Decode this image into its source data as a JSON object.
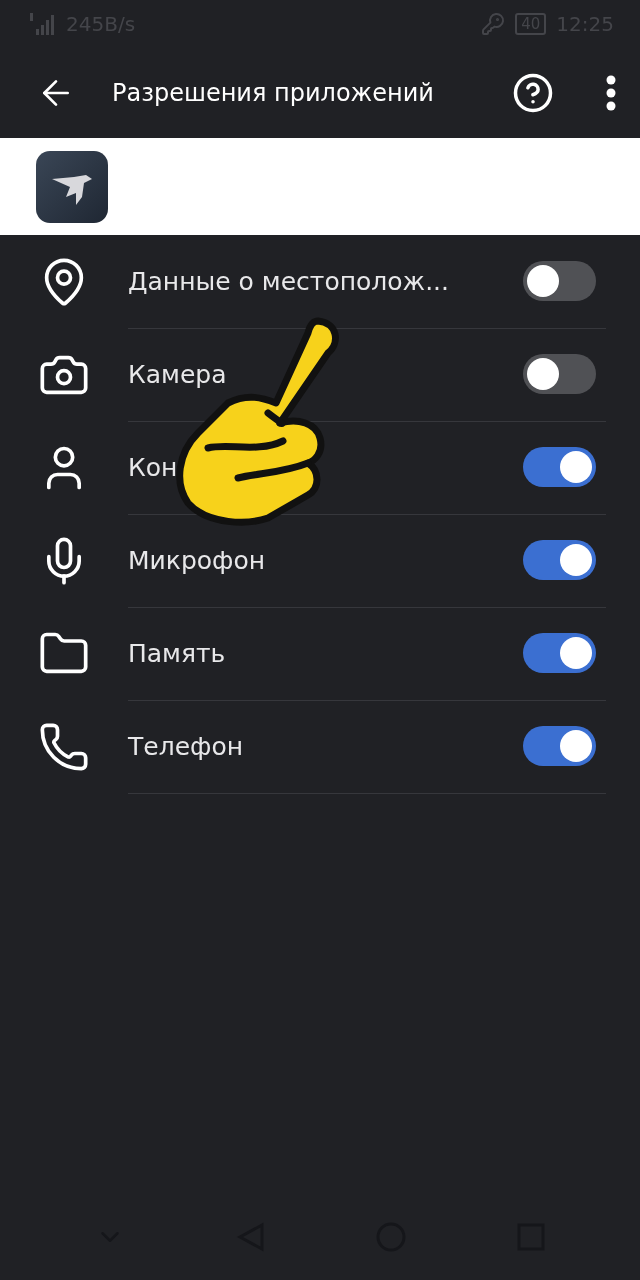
{
  "status_bar": {
    "network_speed": "245B/s",
    "battery": "40",
    "time": "12:25"
  },
  "header": {
    "title": "Разрешения приложений"
  },
  "permissions": [
    {
      "kind": "location",
      "label": "Данные о местополож...",
      "on": false
    },
    {
      "kind": "camera",
      "label": "Камера",
      "on": false
    },
    {
      "kind": "contacts",
      "label": "Кон",
      "on": true
    },
    {
      "kind": "microphone",
      "label": "Микрофон",
      "on": true
    },
    {
      "kind": "storage",
      "label": "Память",
      "on": true
    },
    {
      "kind": "phone",
      "label": "Телефон",
      "on": true
    }
  ]
}
